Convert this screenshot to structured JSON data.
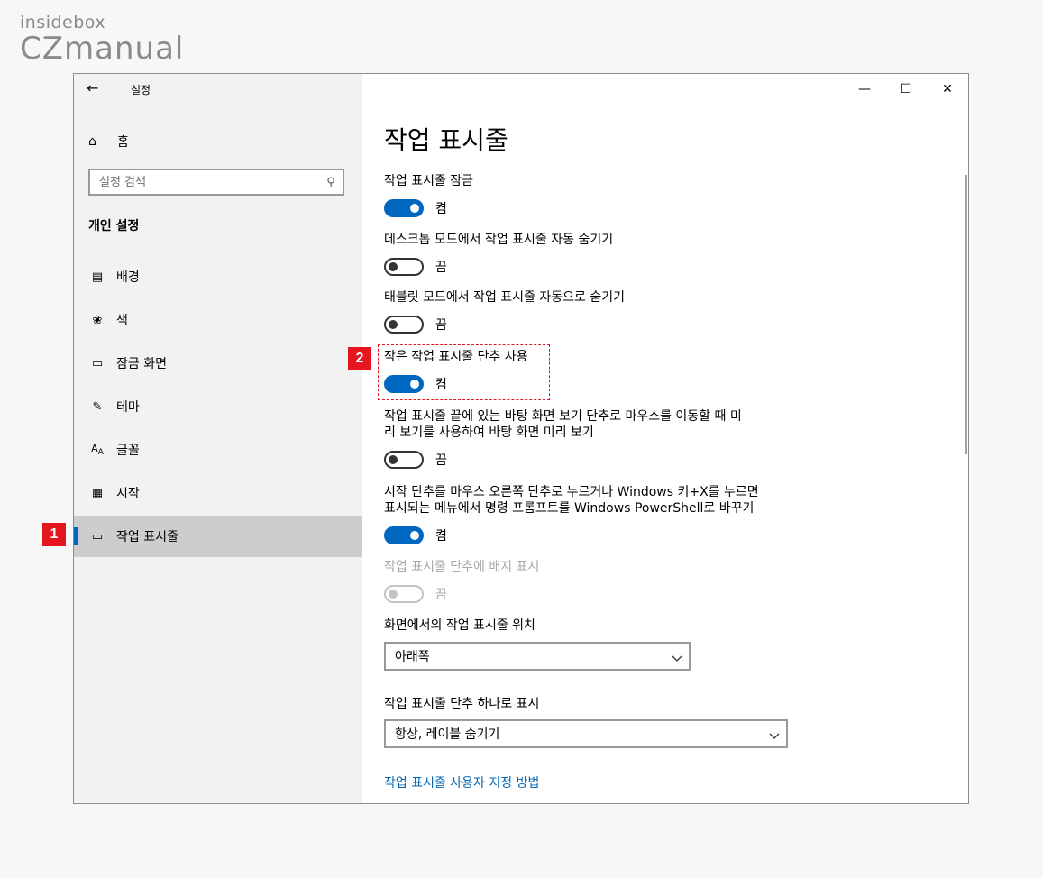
{
  "brand": {
    "top_text": "insidebox",
    "main_text": "CZmanual"
  },
  "window": {
    "title": "설정"
  },
  "sidebar": {
    "home_label": "홈",
    "search_placeholder": "설정 검색",
    "section_title": "개인 설정",
    "items": [
      {
        "label": "배경",
        "icon": "image-icon"
      },
      {
        "label": "색",
        "icon": "palette-icon"
      },
      {
        "label": "잠금 화면",
        "icon": "lock-screen-icon"
      },
      {
        "label": "테마",
        "icon": "theme-icon"
      },
      {
        "label": "글꼴",
        "icon": "font-icon"
      },
      {
        "label": "시작",
        "icon": "start-icon"
      },
      {
        "label": "작업 표시줄",
        "icon": "taskbar-icon",
        "selected": true
      }
    ]
  },
  "main": {
    "title": "작업 표시줄",
    "settings": [
      {
        "label": "작업 표시줄 잠금",
        "state": "켬",
        "on": true
      },
      {
        "label": "데스크톱 모드에서 작업 표시줄 자동 숨기기",
        "state": "끔",
        "on": false
      },
      {
        "label": "태블릿 모드에서 작업 표시줄 자동으로 숨기기",
        "state": "끔",
        "on": false
      },
      {
        "label": "작은 작업 표시줄 단추 사용",
        "state": "켬",
        "on": true
      },
      {
        "label_line1": "작업 표시줄 끝에 있는 바탕 화면 보기 단추로 마우스를 이동할 때 미",
        "label_line2": "리 보기를 사용하여 바탕 화면 미리 보기",
        "state": "끔",
        "on": false
      },
      {
        "label_line1": "시작 단추를 마우스 오른쪽 단추로 누르거나 Windows 키+X를 누르면",
        "label_line2": "표시되는 메뉴에서 명령 프롬프트를 Windows PowerShell로 바꾸기",
        "state": "켬",
        "on": true
      },
      {
        "label": "작업 표시줄 단추에 배지 표시",
        "state": "끔",
        "on": false,
        "disabled": true
      }
    ],
    "position": {
      "label": "화면에서의 작업 표시줄 위치",
      "value": "아래쪽"
    },
    "combine": {
      "label": "작업 표시줄 단추 하나로 표시",
      "value": "항상, 레이블 숨기기"
    },
    "link": "작업 표시줄 사용자 지정 방법"
  },
  "annotations": {
    "badge1": "1",
    "badge2": "2"
  },
  "colors": {
    "accent": "#0067c0",
    "link": "#0067b8",
    "annotation": "#e5161f"
  }
}
